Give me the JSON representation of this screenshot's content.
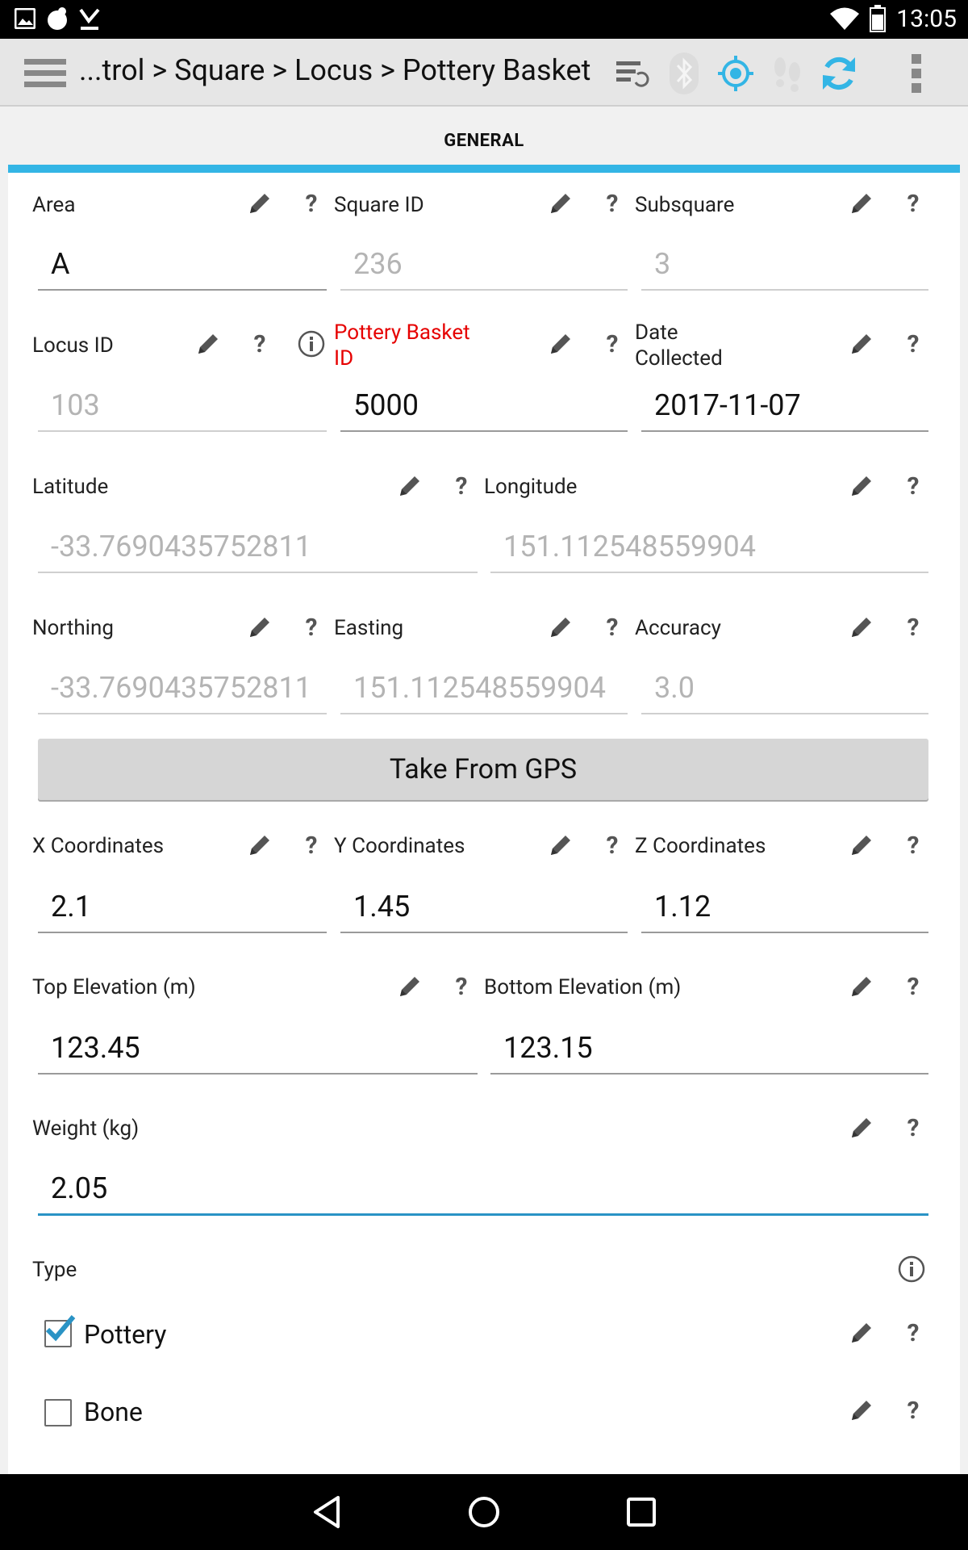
{
  "status_bar": {
    "time": "13:05",
    "icons": [
      "image-icon",
      "cloud-icon",
      "download-check-icon",
      "wifi-icon",
      "battery-icon"
    ]
  },
  "action_bar": {
    "breadcrumb": "...trol > Square > Locus > Pottery Basket",
    "icons": [
      "menu-icon",
      "sync-settings-icon",
      "bluetooth-icon",
      "gps-target-icon",
      "footsteps-icon",
      "refresh-icon",
      "overflow-icon"
    ],
    "colors": {
      "gps_active": "#33b5e5",
      "inactive": "#c8c8c8"
    }
  },
  "tabs": [
    {
      "label": "GENERAL",
      "selected": true
    }
  ],
  "accent_color": "#33b5e5",
  "fields": {
    "area": {
      "label": "Area",
      "value": "A"
    },
    "square_id": {
      "label": "Square ID",
      "value": "236"
    },
    "subsquare": {
      "label": "Subsquare",
      "value": "3"
    },
    "locus_id": {
      "label": "Locus ID",
      "value": "103"
    },
    "pottery_basket_id": {
      "label_line1": "Pottery Basket",
      "label_line2": "ID",
      "value": "5000"
    },
    "date_collected": {
      "label_line1": "Date",
      "label_line2": "Collected",
      "value": "2017-11-07"
    },
    "latitude": {
      "label": "Latitude",
      "value": "-33.7690435752811"
    },
    "longitude": {
      "label": "Longitude",
      "value": "151.112548559904"
    },
    "northing": {
      "label": "Northing",
      "value": "-33.7690435752811"
    },
    "easting": {
      "label": "Easting",
      "value": "151.112548559904"
    },
    "accuracy": {
      "label": "Accuracy",
      "value": "3.0"
    },
    "x_coordinates": {
      "label": "X Coordinates",
      "value": "2.1"
    },
    "y_coordinates": {
      "label": "Y Coordinates",
      "value": "1.45"
    },
    "z_coordinates": {
      "label": "Z Coordinates",
      "value": "1.12"
    },
    "top_elevation": {
      "label": "Top Elevation (m)",
      "value": "123.45"
    },
    "bottom_elevation": {
      "label": "Bottom Elevation (m)",
      "value": "123.15"
    },
    "weight": {
      "label": "Weight (kg)",
      "value": "2.05"
    }
  },
  "gps_button": {
    "label": "Take From GPS"
  },
  "help_mark": "?",
  "type_section": {
    "label": "Type",
    "options": [
      {
        "label": "Pottery",
        "checked": true
      },
      {
        "label": "Bone",
        "checked": false
      }
    ]
  },
  "nav_bar": {
    "icons": [
      "back-icon",
      "home-icon",
      "recents-icon"
    ]
  }
}
